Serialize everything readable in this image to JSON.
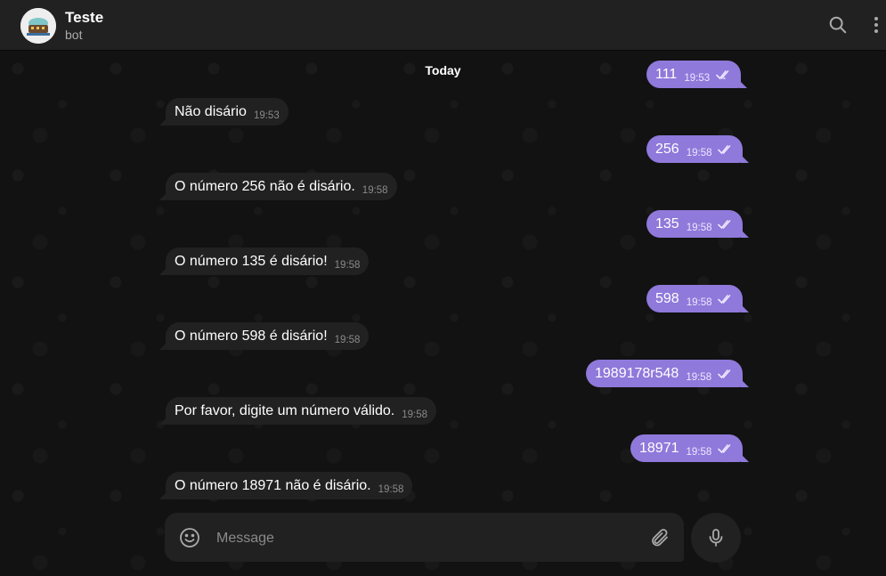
{
  "chat": {
    "title": "Teste",
    "status": "bot"
  },
  "date_divider": "Today",
  "messages": [
    {
      "dir": "out",
      "text": "111",
      "time": "19:53"
    },
    {
      "dir": "in",
      "text": "Não disário",
      "time": "19:53"
    },
    {
      "dir": "out",
      "text": "256",
      "time": "19:58"
    },
    {
      "dir": "in",
      "text": "O número 256 não é disário.",
      "time": "19:58"
    },
    {
      "dir": "out",
      "text": "135",
      "time": "19:58"
    },
    {
      "dir": "in",
      "text": "O número 135 é disário!",
      "time": "19:58"
    },
    {
      "dir": "out",
      "text": "598",
      "time": "19:58"
    },
    {
      "dir": "in",
      "text": "O número 598 é disário!",
      "time": "19:58"
    },
    {
      "dir": "out",
      "text": "1989178r548",
      "time": "19:58"
    },
    {
      "dir": "in",
      "text": "Por favor, digite um número válido.",
      "time": "19:58"
    },
    {
      "dir": "out",
      "text": "18971",
      "time": "19:58"
    },
    {
      "dir": "in",
      "text": "O número 18971 não é disário.",
      "time": "19:58"
    }
  ],
  "composer": {
    "placeholder": "Message"
  },
  "icons": {
    "search": "search-icon",
    "menu": "more-vertical-icon",
    "emoji": "smile-icon",
    "attach": "paperclip-icon",
    "mic": "microphone-icon",
    "read": "double-check-icon"
  },
  "colors": {
    "outgoing_bubble": "#8f79da",
    "incoming_bubble": "#212121",
    "header": "#212121",
    "background": "#121212"
  }
}
